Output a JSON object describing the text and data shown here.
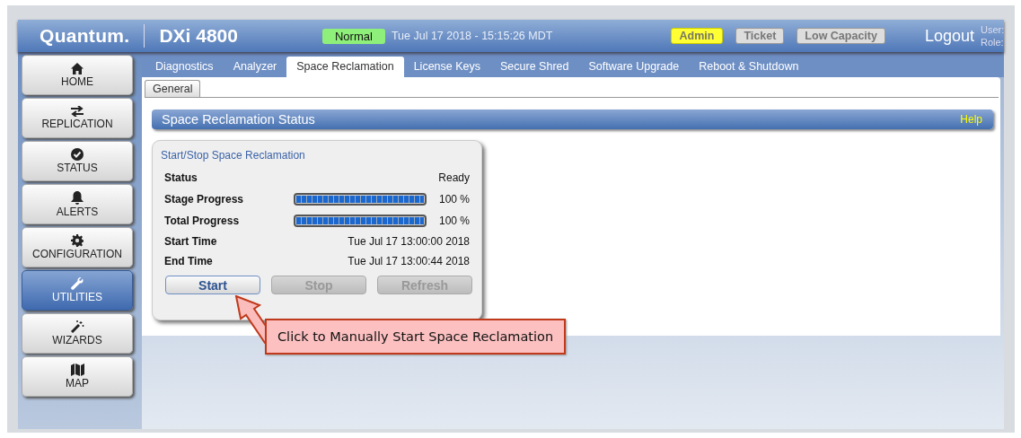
{
  "header": {
    "logo": "Quantum.",
    "product": "DXi 4800",
    "status": "Normal",
    "datetime": "Tue Jul 17 2018 - 15:15:26 MDT",
    "badges": [
      {
        "label": "Admin",
        "active": true
      },
      {
        "label": "Ticket",
        "active": false
      },
      {
        "label": "Low Capacity",
        "active": false
      }
    ],
    "logout": "Logout",
    "user_label": "User:",
    "role_label": "Role:"
  },
  "tabs": [
    {
      "label": "Diagnostics",
      "selected": false
    },
    {
      "label": "Analyzer",
      "selected": false
    },
    {
      "label": "Space Reclamation",
      "selected": true
    },
    {
      "label": "License Keys",
      "selected": false
    },
    {
      "label": "Secure Shred",
      "selected": false
    },
    {
      "label": "Software Upgrade",
      "selected": false
    },
    {
      "label": "Reboot & Shutdown",
      "selected": false
    }
  ],
  "sidebar": {
    "items": [
      {
        "label": "HOME",
        "selected": false
      },
      {
        "label": "REPLICATION",
        "selected": false
      },
      {
        "label": "STATUS",
        "selected": false
      },
      {
        "label": "ALERTS",
        "selected": false
      },
      {
        "label": "CONFIGURATION",
        "selected": false
      },
      {
        "label": "UTILITIES",
        "selected": true
      },
      {
        "label": "WIZARDS",
        "selected": false
      },
      {
        "label": "MAP",
        "selected": false
      }
    ]
  },
  "subtabs": [
    {
      "label": "General",
      "selected": true
    }
  ],
  "section": {
    "title": "Space Reclamation Status",
    "help": "Help"
  },
  "panel": {
    "title": "Start/Stop Space Reclamation",
    "rows": [
      {
        "kind": "text",
        "label": "Status",
        "value": "Ready"
      },
      {
        "kind": "progress",
        "label": "Stage Progress",
        "level": 1,
        "value": "100 %"
      },
      {
        "kind": "progress",
        "label": "Total Progress",
        "level": 1,
        "value": "100 %"
      },
      {
        "kind": "text",
        "label": "Start Time",
        "value": "Tue Jul 17 13:00:00 2018"
      },
      {
        "kind": "text",
        "label": "End Time",
        "value": "Tue Jul 17 13:00:44 2018"
      }
    ],
    "buttons": [
      {
        "label": "Start",
        "disabled": false
      },
      {
        "label": "Stop",
        "disabled": true
      },
      {
        "label": "Refresh",
        "disabled": true
      }
    ]
  },
  "callout": "Click to Manually Start Space Reclamation"
}
